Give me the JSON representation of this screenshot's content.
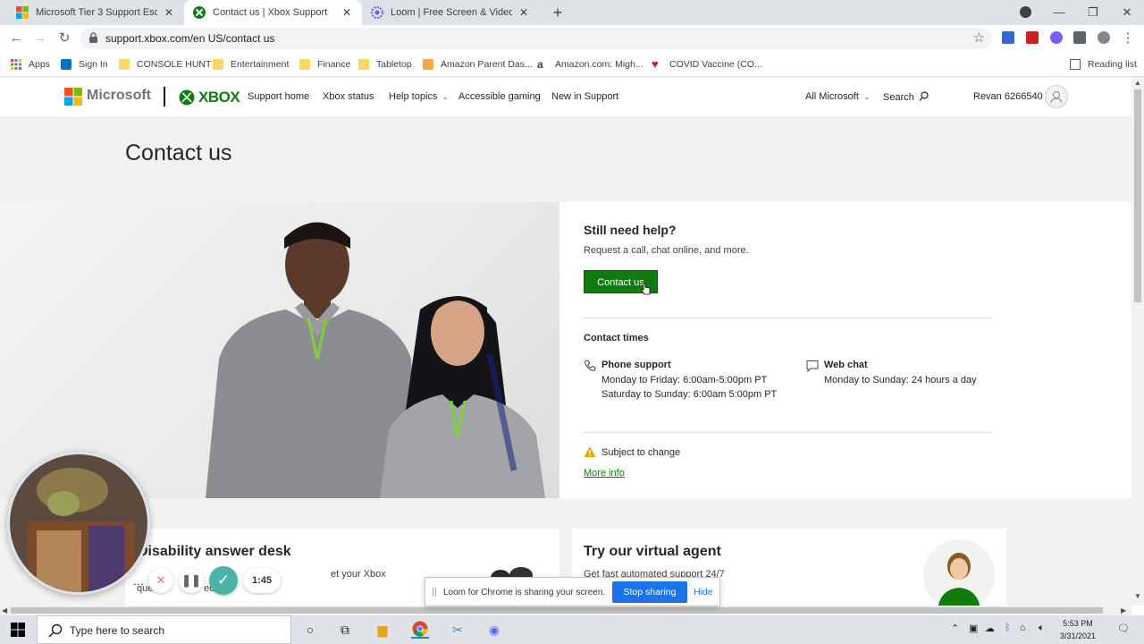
{
  "browser": {
    "tabs": [
      {
        "title": "Microsoft Tier 3 Support Escalati",
        "active": false
      },
      {
        "title": "Contact us | Xbox Support",
        "active": true
      },
      {
        "title": "Loom | Free Screen & Video Reco",
        "active": false
      }
    ],
    "new_tab": "+",
    "window": {
      "minimize": "—",
      "restore": "❐",
      "close": "✕"
    },
    "url": "support.xbox.com/en US/contact us",
    "bookmarks": [
      {
        "label": "Apps"
      },
      {
        "label": "Sign In"
      },
      {
        "label": "CONSOLE HUNT"
      },
      {
        "label": "Entertainment"
      },
      {
        "label": "Finance"
      },
      {
        "label": "Tabletop"
      },
      {
        "label": "Amazon Parent Das..."
      },
      {
        "label": "Amazon.com: Migh..."
      },
      {
        "label": "COVID Vaccine (CO..."
      }
    ],
    "reading_list": "Reading list"
  },
  "site": {
    "ms_brand": "Microsoft",
    "xbox_brand": "XBOX",
    "nav": [
      "Support home",
      "Xbox status",
      "Help topics",
      "Accessible gaming",
      "New in Support"
    ],
    "all_microsoft": "All Microsoft",
    "search": "Search",
    "user": "Revan 6266540"
  },
  "page": {
    "title": "Contact us",
    "help": {
      "heading": "Still need help?",
      "subtitle": "Request a call, chat online, and more.",
      "button": "Contact us"
    },
    "contact_times": {
      "heading": "Contact times",
      "phone_title": "Phone support",
      "phone_line1": "Monday to Friday: 6:00am-5:00pm PT",
      "phone_line2": "Saturday to Sunday: 6:00am 5:00pm PT",
      "chat_title": "Web chat",
      "chat_line1": "Monday to Sunday: 24 hours a day"
    },
    "notice": "Subject to change",
    "more_info": "More info",
    "disability": {
      "title": "Disability answer desk",
      "line1": "et your Xbox",
      "line2_a": "questi",
      "line2_b": "ed."
    },
    "virtual_agent": {
      "title": "Try our virtual agent",
      "subtitle": "Get fast automated support 24/7"
    }
  },
  "loom": {
    "timer": "1:45",
    "share_text": "Loom for Chrome is sharing your screen.",
    "stop": "Stop sharing",
    "hide": "Hide"
  },
  "taskbar": {
    "search_placeholder": "Type here to search",
    "time": "5:53 PM",
    "date": "3/31/2021"
  },
  "colors": {
    "xbox_green": "#107c10",
    "link_blue": "#1a73e8"
  }
}
